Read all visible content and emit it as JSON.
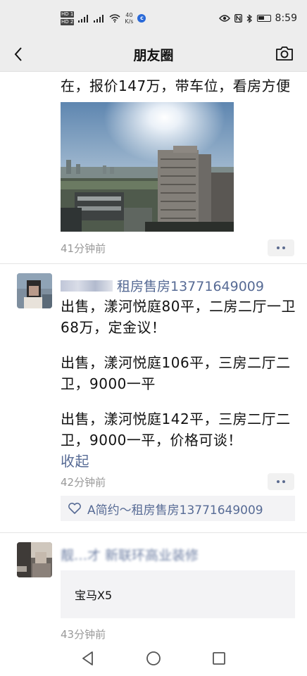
{
  "status_bar": {
    "hd1": "HD 1",
    "hd2": "HD 2",
    "net_speed_value": "40",
    "net_speed_unit": "K/s",
    "time": "8:59"
  },
  "header": {
    "title": "朋友圈"
  },
  "post1": {
    "text_tail": "在，报价147万，带车位，看房方便",
    "time": "41分钟前"
  },
  "post2": {
    "author": "租房售房13771649009",
    "paragraphs": [
      "出售，漾河悦庭80平，二房二厅一卫68万，定金议！",
      "出售，漾河悦庭106平，三房二厅二卫，9000一平",
      "出售，漾河悦庭142平，三房二厅二卫，9000一平，价格可谈！"
    ],
    "collapse_label": "收起",
    "time": "42分钟前",
    "likes": "A简约～租房售房13771649009"
  },
  "post3": {
    "author": "靓…才 新联环高业装修",
    "link_card": "宝马X5",
    "time": "43分钟前"
  },
  "colors": {
    "link": "#576b95",
    "meta": "#999999",
    "bar_bg": "#ededed"
  },
  "icons": {
    "back": "chevron-left-icon",
    "camera": "camera-icon",
    "more": "more-dots-icon",
    "like": "heart-icon",
    "nav_back": "triangle-back-icon",
    "nav_home": "circle-home-icon",
    "nav_recent": "square-recent-icon"
  }
}
